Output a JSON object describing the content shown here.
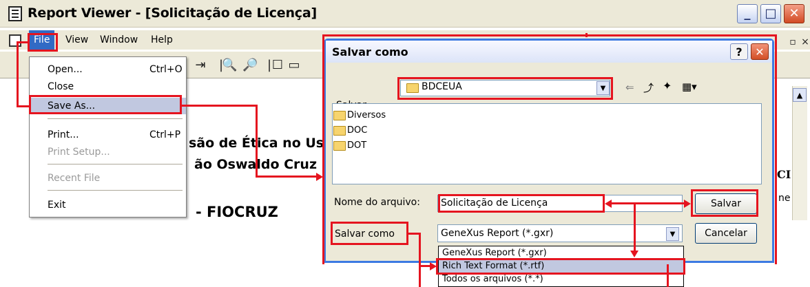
{
  "main_window": {
    "title": "Report Viewer - [Solicitação de Licença]",
    "controls": {
      "minimize": "_",
      "maximize": "□",
      "close": "✕"
    }
  },
  "menubar": {
    "file": "File",
    "view": "View",
    "window": "Window",
    "help": "Help"
  },
  "file_menu": {
    "open": {
      "label": "Open...",
      "shortcut": "Ctrl+O"
    },
    "close": {
      "label": "Close"
    },
    "save_as": {
      "label": "Save As..."
    },
    "print": {
      "label": "Print...",
      "shortcut": "Ctrl+P"
    },
    "print_setup": {
      "label": "Print Setup..."
    },
    "recent_file": {
      "label": "Recent File"
    },
    "exit": {
      "label": "Exit"
    }
  },
  "document": {
    "line1": "são de Ética no Us",
    "line2": "ão Oswaldo Cruz",
    "line3": "- FIOCRUZ",
    "side_right_1": "CI",
    "side_right_2": "ne"
  },
  "dialog": {
    "title": "Salvar como",
    "help_button": "?",
    "close_button": "✕",
    "save_in_label": "Salvar",
    "save_in_value": "BDCEUA",
    "files": [
      "Diversos",
      "DOC",
      "DOT"
    ],
    "filename_label": "Nome do arquivo:",
    "filename_value": "Solicitação de Licença",
    "filetype_label": "Salvar como",
    "filetype_value": "GeneXus Report (*.gxr)",
    "save_button": "Salvar",
    "cancel_button": "Cancelar",
    "filetype_options": [
      "GeneXus Report (*.gxr)",
      "Rich Text Format (*.rtf)",
      "Todos os arquivos (*.*)"
    ]
  },
  "colors": {
    "annotation": "#e5141f",
    "selection": "#c1c8e0",
    "menu_active": "#316ac5"
  }
}
